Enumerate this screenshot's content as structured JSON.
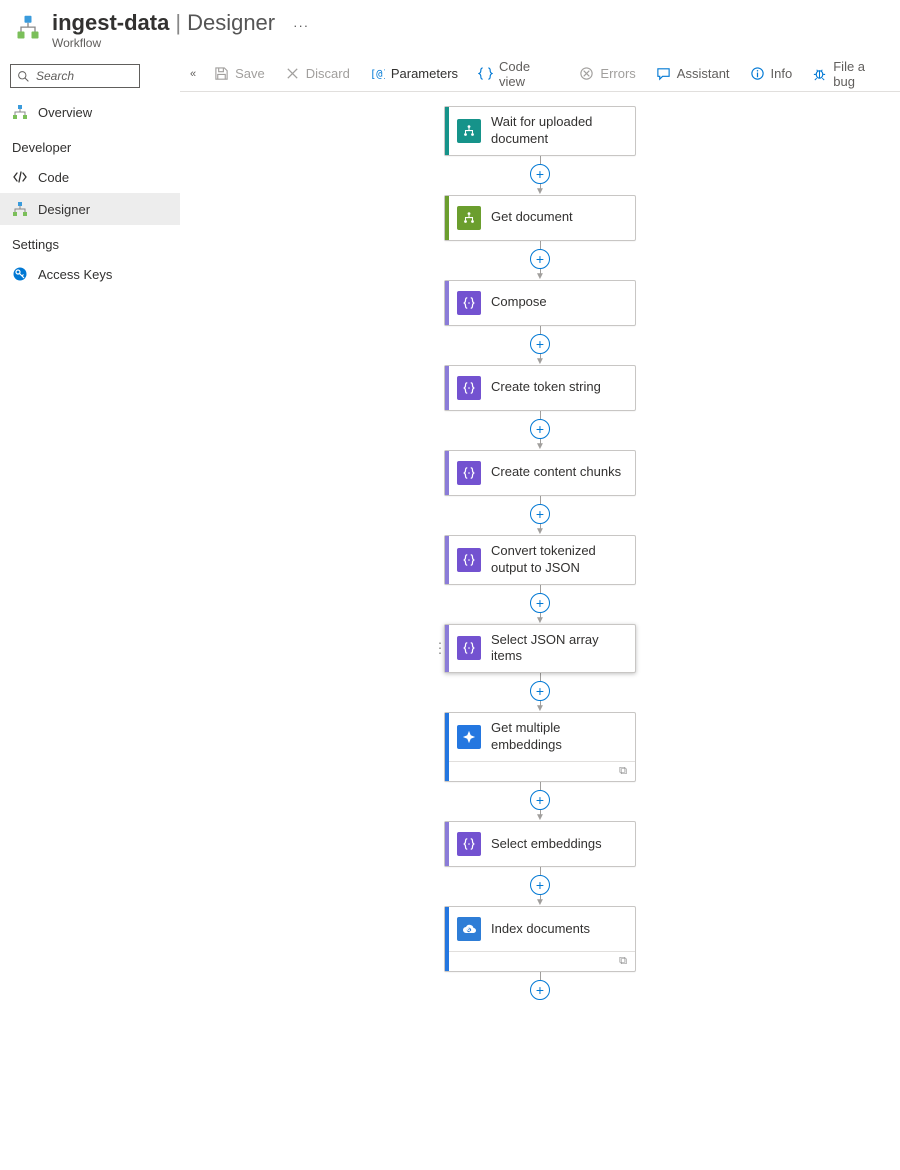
{
  "header": {
    "name": "ingest-data",
    "section": "Designer",
    "subtitle": "Workflow",
    "more": "···"
  },
  "sidebar": {
    "search_placeholder": "Search",
    "items": {
      "overview": "Overview",
      "code": "Code",
      "designer": "Designer",
      "access_keys": "Access Keys"
    },
    "headings": {
      "developer": "Developer",
      "settings": "Settings"
    }
  },
  "toolbar": {
    "collapse": "«",
    "save": "Save",
    "discard": "Discard",
    "parameters": "Parameters",
    "code_view": "Code view",
    "errors": "Errors",
    "assistant": "Assistant",
    "info": "Info",
    "file_bug": "File a bug"
  },
  "nodes": [
    {
      "id": "wait-upload",
      "label": "Wait for uploaded document",
      "icon_type": "tree",
      "accent": "accent-teal",
      "icon_bg": "teal",
      "footer": false,
      "selected": false
    },
    {
      "id": "get-document",
      "label": "Get document",
      "icon_type": "tree",
      "accent": "accent-olive",
      "icon_bg": "olive",
      "footer": false,
      "selected": false
    },
    {
      "id": "compose",
      "label": "Compose",
      "icon_type": "braces",
      "accent": "accent-purple",
      "icon_bg": "purple",
      "footer": false,
      "selected": false
    },
    {
      "id": "create-token",
      "label": "Create token string",
      "icon_type": "braces",
      "accent": "accent-purple",
      "icon_bg": "purple",
      "footer": false,
      "selected": false
    },
    {
      "id": "create-chunks",
      "label": "Create content chunks",
      "icon_type": "braces",
      "accent": "accent-purple",
      "icon_bg": "purple",
      "footer": false,
      "selected": false
    },
    {
      "id": "convert-json",
      "label": "Convert tokenized output to JSON",
      "icon_type": "braces",
      "accent": "accent-purple",
      "icon_bg": "purple",
      "footer": false,
      "selected": false
    },
    {
      "id": "select-json",
      "label": "Select JSON array items",
      "icon_type": "braces",
      "accent": "accent-purple",
      "icon_bg": "purple",
      "footer": false,
      "selected": true
    },
    {
      "id": "get-embed",
      "label": "Get multiple embeddings",
      "icon_type": "spark",
      "accent": "accent-azure",
      "icon_bg": "azure",
      "footer": true,
      "selected": false
    },
    {
      "id": "select-embed",
      "label": "Select embeddings",
      "icon_type": "braces",
      "accent": "accent-purple",
      "icon_bg": "purple",
      "footer": false,
      "selected": false
    },
    {
      "id": "index-docs",
      "label": "Index documents",
      "icon_type": "cloud",
      "accent": "accent-azure",
      "icon_bg": "cloud",
      "footer": true,
      "selected": false
    }
  ]
}
